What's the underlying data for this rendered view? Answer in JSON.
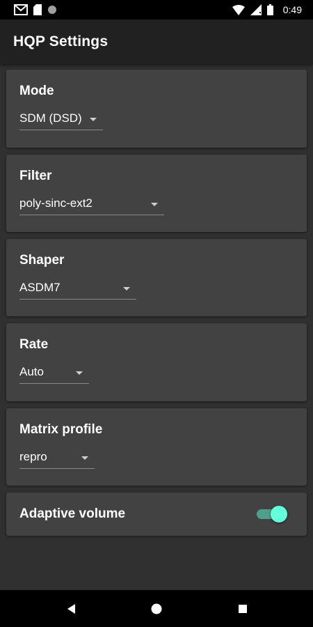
{
  "status_bar": {
    "time": "0:49",
    "left_icons": [
      "gmail-icon",
      "sd-card-icon",
      "circle-icon"
    ],
    "right_icons": [
      "wifi-icon",
      "signal-icon",
      "battery-icon"
    ]
  },
  "app_bar": {
    "title": "HQP Settings"
  },
  "settings": {
    "mode": {
      "label": "Mode",
      "value": "SDM (DSD)"
    },
    "filter": {
      "label": "Filter",
      "value": "poly-sinc-ext2"
    },
    "shaper": {
      "label": "Shaper",
      "value": "ASDM7"
    },
    "rate": {
      "label": "Rate",
      "value": "Auto"
    },
    "matrix_profile": {
      "label": "Matrix profile",
      "value": "repro"
    },
    "adaptive_volume": {
      "label": "Adaptive volume",
      "enabled": true
    }
  },
  "nav_bar": {
    "buttons": [
      "back-icon",
      "home-icon",
      "recents-icon"
    ]
  },
  "colors": {
    "background": "#303030",
    "app_bar": "#212121",
    "card": "#424242",
    "accent": "#64ffda",
    "status_bar": "#000000"
  }
}
